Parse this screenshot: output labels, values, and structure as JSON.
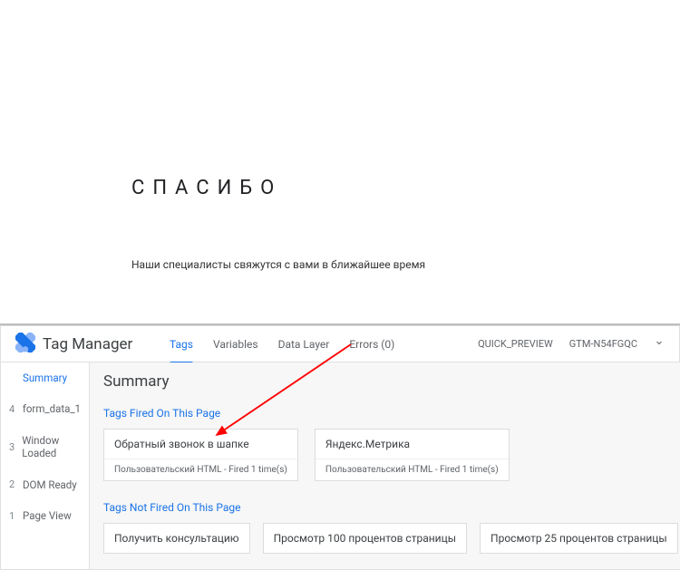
{
  "page": {
    "thankyou": "СПАСИБО",
    "subtext": "Наши специалисты свяжутся с вами в ближайшее время"
  },
  "gtm": {
    "title": "Tag Manager",
    "tabs": {
      "tags": "Tags",
      "variables": "Variables",
      "dataLayer": "Data Layer",
      "errors": "Errors (0)"
    },
    "env": "QUICK_PREVIEW",
    "container": "GTM-N54FGQC",
    "sidebar": {
      "summary": "Summary",
      "rows": [
        {
          "num": "4",
          "label": "form_data_1"
        },
        {
          "num": "3",
          "label": "Window Loaded"
        },
        {
          "num": "2",
          "label": "DOM Ready"
        },
        {
          "num": "1",
          "label": "Page View"
        }
      ]
    },
    "main": {
      "title": "Summary",
      "firedSection": "Tags Fired On This Page",
      "firedTags": [
        {
          "title": "Обратный звонок в шапке",
          "sub": "Пользовательский HTML - Fired 1 time(s)"
        },
        {
          "title": "Яндекс.Метрика",
          "sub": "Пользовательский HTML - Fired 1 time(s)"
        }
      ],
      "notFiredSection": "Tags Not Fired On This Page",
      "notFiredTags": [
        {
          "title": "Получить консультацию"
        },
        {
          "title": "Просмотр 100 процентов страницы"
        },
        {
          "title": "Просмотр 25 процентов страницы"
        }
      ]
    }
  }
}
